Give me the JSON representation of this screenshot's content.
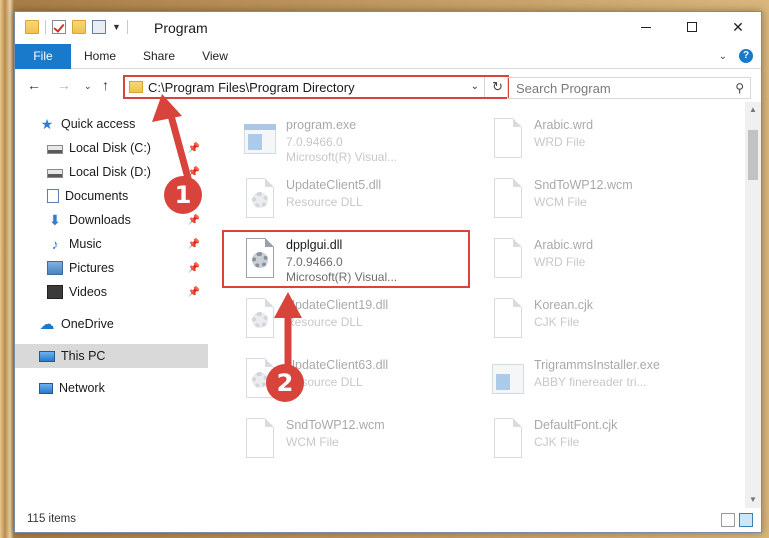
{
  "window": {
    "title": "Program",
    "controls": {
      "minimize": "",
      "maximize": "",
      "close": "✕"
    }
  },
  "ribbon": {
    "tabs": [
      {
        "label": "File"
      },
      {
        "label": "Home"
      },
      {
        "label": "Share"
      },
      {
        "label": "View"
      }
    ]
  },
  "navigation": {
    "address": "C:\\Program Files\\Program Directory",
    "search_placeholder": "Search Program"
  },
  "sidebar": {
    "items": [
      {
        "label": "Quick access",
        "icon": "star-icon"
      },
      {
        "label": "Local Disk (C:)",
        "icon": "drive-icon",
        "pinned": true
      },
      {
        "label": "Local Disk (D:)",
        "icon": "drive-icon",
        "pinned": true
      },
      {
        "label": "Documents",
        "icon": "documents-icon",
        "pinned": true
      },
      {
        "label": "Downloads",
        "icon": "downloads-icon",
        "pinned": true
      },
      {
        "label": "Music",
        "icon": "music-icon",
        "pinned": true
      },
      {
        "label": "Pictures",
        "icon": "pictures-icon",
        "pinned": true
      },
      {
        "label": "Videos",
        "icon": "videos-icon",
        "pinned": true
      },
      {
        "label": "OneDrive",
        "icon": "onedrive-icon"
      },
      {
        "label": "This PC",
        "icon": "pc-icon",
        "selected": true
      },
      {
        "label": "Network",
        "icon": "network-icon"
      }
    ]
  },
  "files": [
    {
      "name": "program.exe",
      "line1": "7.0.9466.0",
      "line2": "Microsoft(R) Visual...",
      "icon": "exe-icon"
    },
    {
      "name": "Arabic.wrd",
      "line1": "WRD File",
      "line2": "",
      "icon": "doc-icon"
    },
    {
      "name": "UpdateClient5.dll",
      "line1": "Resource DLL",
      "line2": "",
      "icon": "dll-icon"
    },
    {
      "name": "SndToWP12.wcm",
      "line1": "WCM File",
      "line2": "",
      "icon": "doc-icon"
    },
    {
      "name": "dpplgui.dll",
      "line1": "7.0.9466.0",
      "line2": "Microsoft(R) Visual...",
      "icon": "dll-icon",
      "highlighted": true
    },
    {
      "name": "Arabic.wrd",
      "line1": "WRD File",
      "line2": "",
      "icon": "doc-icon"
    },
    {
      "name": "UpdateClient19.dll",
      "line1": "Resource DLL",
      "line2": "",
      "icon": "dll-icon"
    },
    {
      "name": "Korean.cjk",
      "line1": "CJK File",
      "line2": "",
      "icon": "doc-icon"
    },
    {
      "name": "UpdateClient63.dll",
      "line1": "Resource DLL",
      "line2": "",
      "icon": "dll-icon"
    },
    {
      "name": "TrigrammsInstaller.exe",
      "line1": "ABBY finereader tri...",
      "line2": "",
      "icon": "exe-icon"
    },
    {
      "name": "SndToWP12.wcm",
      "line1": "WCM File",
      "line2": "",
      "icon": "doc-icon"
    },
    {
      "name": "DefaultFont.cjk",
      "line1": "CJK File",
      "line2": "",
      "icon": "doc-icon"
    }
  ],
  "status": {
    "item_count": "115 items"
  },
  "annotations": {
    "callout_1": "1",
    "callout_2": "2"
  },
  "colors": {
    "accent": "#1979ca",
    "annotation_red": "#d8443c",
    "selected_bg": "#d9d9d9"
  }
}
